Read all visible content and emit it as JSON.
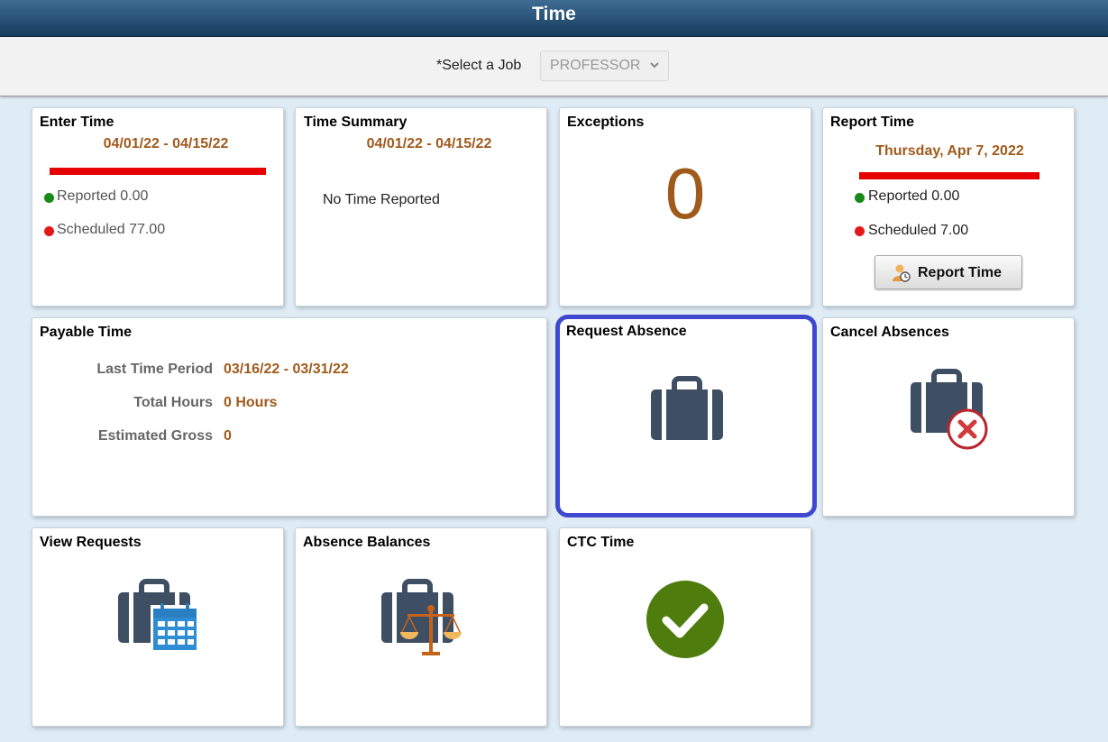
{
  "header": {
    "title": "Time"
  },
  "job_select": {
    "label": "*Select a Job",
    "value": "PROFESSOR"
  },
  "tiles": {
    "enter_time": {
      "title": "Enter Time",
      "period": "04/01/22 - 04/15/22",
      "reported": "Reported 0.00",
      "scheduled": "Scheduled 77.00"
    },
    "time_summary": {
      "title": "Time Summary",
      "period": "04/01/22 - 04/15/22",
      "message": "No Time Reported"
    },
    "exceptions": {
      "title": "Exceptions",
      "count": "0"
    },
    "report_time": {
      "title": "Report Time",
      "date": "Thursday, Apr 7, 2022",
      "reported": "Reported 0.00",
      "scheduled": "Scheduled 7.00",
      "button_label": "Report Time"
    },
    "payable_time": {
      "title": "Payable Time",
      "rows": [
        {
          "label": "Last Time Period",
          "value": "03/16/22 - 03/31/22"
        },
        {
          "label": "Total Hours",
          "value": "0 Hours"
        },
        {
          "label": "Estimated Gross",
          "value": "0"
        }
      ]
    },
    "request_absence": {
      "title": "Request Absence",
      "icon": "briefcase-icon"
    },
    "cancel_absences": {
      "title": "Cancel Absences",
      "icon": "briefcase-cancel-icon"
    },
    "view_requests": {
      "title": "View Requests",
      "icon": "briefcase-calendar-icon"
    },
    "absence_balances": {
      "title": "Absence Balances",
      "icon": "briefcase-scale-icon"
    },
    "ctc_time": {
      "title": "CTC Time",
      "icon": "checkmark-icon"
    }
  },
  "colors": {
    "accent_orange": "#a05a1b",
    "briefcase": "#3e4f63",
    "focus_border": "#3f49cf",
    "check_green": "#4e7d0d",
    "alert_red": "#e60000"
  }
}
